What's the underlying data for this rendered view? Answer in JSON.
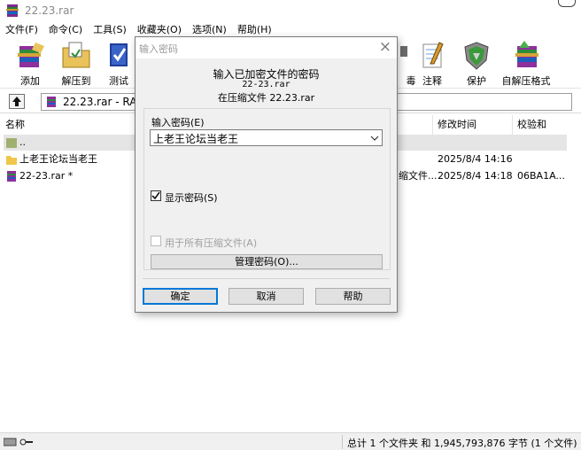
{
  "window": {
    "title": "22.23.rar"
  },
  "menu": [
    "文件(F)",
    "命令(C)",
    "工具(S)",
    "收藏夹(O)",
    "选项(N)",
    "帮助(H)"
  ],
  "toolbar": {
    "add": "添加",
    "extract_to": "解压到",
    "test": "测试",
    "virus_scan_partial": "毒",
    "comment": "注释",
    "protect": "保护",
    "sfx": "自解压格式"
  },
  "address": {
    "path": "22.23.rar - RAR"
  },
  "columns": {
    "name": "名称",
    "modified": "修改时间",
    "checksum": "校验和"
  },
  "files": [
    {
      "name": "..",
      "type_partial": "",
      "modified": "",
      "checksum": ""
    },
    {
      "name": "上老王论坛当老王",
      "type_partial": "",
      "modified": "2025/8/4 14:16",
      "checksum": ""
    },
    {
      "name": "22-23.rar *",
      "type_partial": "缩文件...",
      "modified": "2025/8/4 14:18",
      "checksum": "06BA1A..."
    }
  ],
  "status": {
    "summary": "总计 1 个文件夹 和 1,945,793,876 字节 (1 个文件)"
  },
  "dialog": {
    "title": "输入密码",
    "heading": "输入已加密文件的密码",
    "filename": "22-23.rar",
    "in_archive": "在压缩文件 22.23.rar",
    "password_label": "输入密码(E)",
    "password_value": "上老王论坛当老王",
    "show_password": "显示密码(S)",
    "show_password_checked": true,
    "use_for_all": "用于所有压缩文件(A)",
    "manage_passwords": "管理密码(O)...",
    "ok": "确定",
    "cancel": "取消",
    "help": "帮助"
  }
}
